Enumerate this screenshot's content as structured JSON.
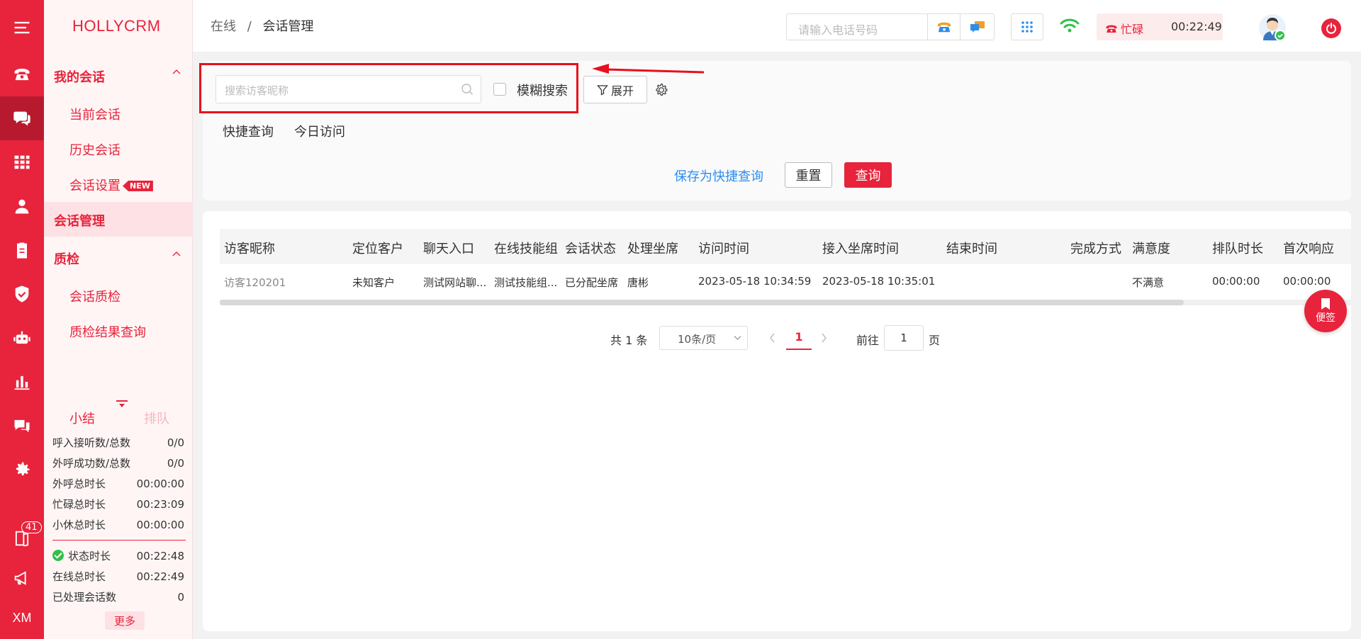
{
  "app": {
    "logo": "HOLLYCRM"
  },
  "rail": {
    "badge_count": "41",
    "xm_label": "XM"
  },
  "sidebar": {
    "my_sessions": "我的会话",
    "current_session": "当前会话",
    "history_session": "历史会话",
    "session_settings": "会话设置",
    "new_badge": "NEW",
    "session_management": "会话管理",
    "quality": "质检",
    "session_quality": "会话质检",
    "quality_result": "质检结果查询",
    "tab_summary": "小结",
    "tab_queue": "排队",
    "stats": [
      {
        "label": "呼入接听数/总数",
        "value": "0/0"
      },
      {
        "label": "外呼成功数/总数",
        "value": "0/0"
      },
      {
        "label": "外呼总时长",
        "value": "00:00:00"
      },
      {
        "label": "忙碌总时长",
        "value": "00:23:09"
      },
      {
        "label": "小休总时长",
        "value": "00:00:00"
      }
    ],
    "stats2": [
      {
        "label": "状态时长",
        "value": "00:22:48"
      },
      {
        "label": "在线总时长",
        "value": "00:22:49"
      },
      {
        "label": "已处理会话数",
        "value": "0"
      }
    ],
    "more": "更多"
  },
  "header": {
    "breadcrumb_1": "在线",
    "breadcrumb_sep": "/",
    "breadcrumb_2": "会话管理",
    "phone_placeholder": "请输入电话号码",
    "status": "忙碌",
    "timer": "00:22:49"
  },
  "filter": {
    "search_placeholder": "搜索访客昵称",
    "fuzzy_label": "模糊搜索",
    "expand_label": "展开",
    "quick_query": "快捷查询",
    "today_visit": "今日访问",
    "save_quick": "保存为快捷查询",
    "reset": "重置",
    "query": "查询"
  },
  "table": {
    "columns": [
      "访客昵称",
      "定位客户",
      "聊天入口",
      "在线技能组",
      "会话状态",
      "处理坐席",
      "访问时间",
      "接入坐席时间",
      "结束时间",
      "完成方式",
      "满意度",
      "排队时长",
      "首次响应"
    ],
    "rows": [
      [
        "访客120201",
        "未知客户",
        "测试网站聊...",
        "测试技能组...",
        "已分配坐席",
        "唐彬",
        "2023-05-18 10:34:59",
        "2023-05-18 10:35:01",
        "",
        "",
        "不满意",
        "00:00:00",
        "00:00:00"
      ]
    ]
  },
  "pagination": {
    "total": "共 1 条",
    "page_size": "10条/页",
    "current": "1",
    "goto_prefix": "前往",
    "goto_value": "1",
    "goto_suffix": "页"
  },
  "note_button": "便签",
  "colors": {
    "brand": "#e8233c",
    "link": "#2d8cf0",
    "success": "#31c04a"
  }
}
